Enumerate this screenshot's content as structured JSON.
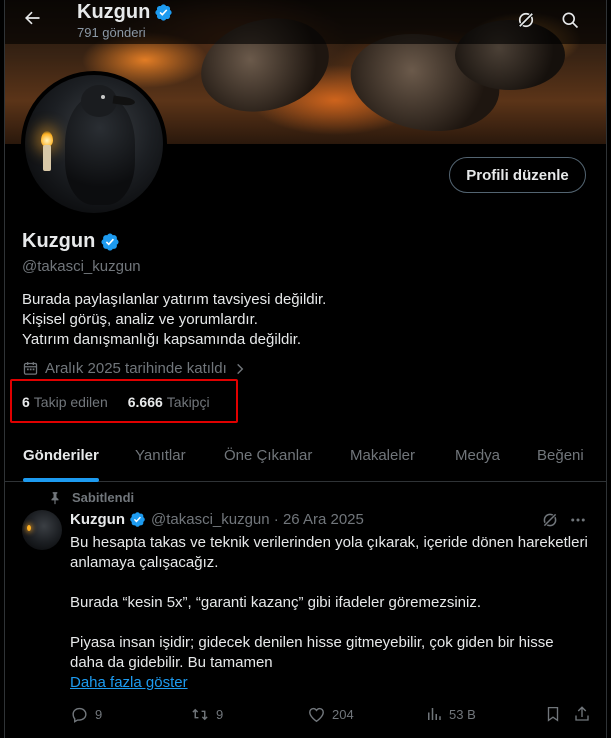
{
  "header": {
    "title": "Kuzgun",
    "post_count": "791 gönderi"
  },
  "profile": {
    "name": "Kuzgun",
    "handle": "@takasci_kuzgun",
    "edit_label": "Profili düzenle",
    "bio": [
      "Burada paylaşılanlar yatırım tavsiyesi değildir.",
      "Kişisel görüş, analiz ve yorumlardır.",
      "Yatırım danışmanlığı kapsamında değildir."
    ],
    "joined": "Aralık 2025 tarihinde katıldı",
    "following_count": "6",
    "following_label": "Takip edilen",
    "followers_count": "6.666",
    "followers_label": "Takipçi"
  },
  "tabs": [
    {
      "label": "Gönderiler"
    },
    {
      "label": "Yanıtlar"
    },
    {
      "label": "Öne Çıkanlar"
    },
    {
      "label": "Makaleler"
    },
    {
      "label": "Medya"
    },
    {
      "label": "Beğeni"
    }
  ],
  "pinned_post": {
    "pinned_label": "Sabitlendi",
    "author": "Kuzgun",
    "meta": "@takasci_kuzgun · 26 Ara 2025",
    "paragraphs": [
      "Bu hesapta takas ve teknik verilerinden yola çıkarak, içeride dönen hareketleri anlamaya çalışacağız.",
      "Burada “kesin 5x”, “garanti kazanç” gibi ifadeler göremezsiniz.",
      "Piyasa insan işidir; gidecek denilen hisse gitmeyebilir, çok giden bir hisse daha da gidebilir. Bu tamamen"
    ],
    "show_more": "Daha fazla göster",
    "replies": "9",
    "reposts": "9",
    "likes": "204",
    "views": "53 B"
  },
  "colors": {
    "accent": "#1d9bf0",
    "highlight_box": "#e00000",
    "verified": "#1d9bf0"
  },
  "icons": [
    "back-arrow-icon",
    "grok-icon",
    "search-icon",
    "verified-badge-icon",
    "calendar-icon",
    "chevron-right-icon",
    "pin-icon",
    "more-icon",
    "reply-icon",
    "repost-icon",
    "like-icon",
    "views-icon",
    "bookmark-icon",
    "share-icon"
  ]
}
